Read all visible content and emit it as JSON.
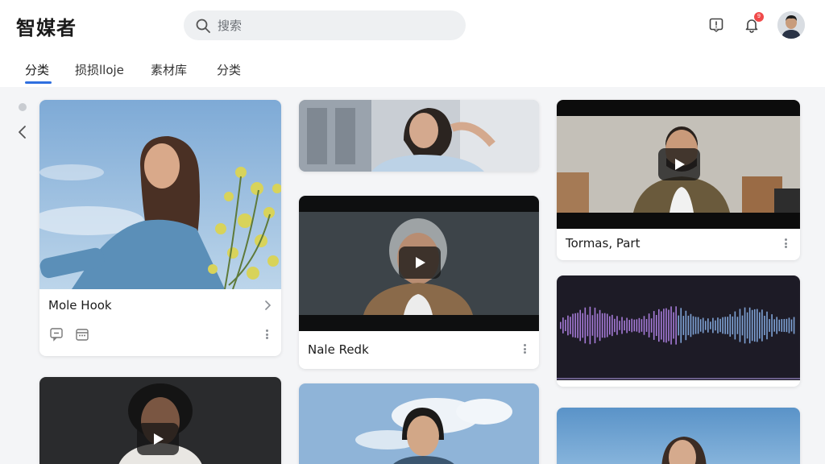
{
  "app": {
    "logo": "智媒者"
  },
  "search": {
    "placeholder": "搜索"
  },
  "header": {
    "notification_count": "9",
    "icons": [
      "message-square-icon",
      "bell-icon",
      "user-avatar"
    ]
  },
  "tabs": [
    {
      "label": "分类",
      "active": true
    },
    {
      "label": "损损lloje",
      "active": false
    },
    {
      "label": "素材库",
      "active": false
    },
    {
      "label": "分类",
      "active": false
    }
  ],
  "cards": [
    {
      "title": "Mole Hook",
      "type": "image"
    },
    {
      "title": "Nale Redk",
      "type": "video"
    },
    {
      "title": "Tormas, Part",
      "type": "video"
    },
    {
      "title": "",
      "type": "audio"
    }
  ],
  "colors": {
    "accent": "#2f6fdf",
    "badge": "#f04a4a",
    "page_bg": "#f4f5f7",
    "waveform": "#9a7cd6"
  }
}
